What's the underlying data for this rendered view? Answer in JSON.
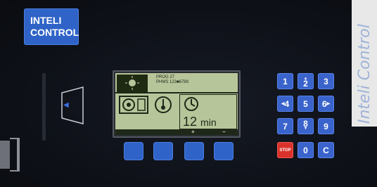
{
  "logo": {
    "line1": "INTELI",
    "line2": "CONTROL"
  },
  "side_label": "Inteli Control",
  "display": {
    "prog_line1": "PROG 27",
    "prog_line2": "PHMS 123■6789",
    "time_value": "12",
    "time_unit": "min",
    "soft_labels": [
      "",
      "",
      "+",
      "−"
    ]
  },
  "keypad": {
    "keys": [
      {
        "label": "1"
      },
      {
        "label": "2",
        "up": true
      },
      {
        "label": "3"
      },
      {
        "label": "4",
        "left": true
      },
      {
        "label": "5"
      },
      {
        "label": "6",
        "right": true
      },
      {
        "label": "7"
      },
      {
        "label": "8",
        "down": true
      },
      {
        "label": "9"
      },
      {
        "label": "STOP"
      },
      {
        "label": "0"
      },
      {
        "label": "C"
      }
    ]
  },
  "colors": {
    "key_blue": "#3a63cc",
    "stop_red": "#d8322a",
    "lcd": "#b7c59a"
  },
  "icons": [
    "card-arrow-icon",
    "washing-drum-icon",
    "temperature-icon",
    "spin-icon"
  ]
}
